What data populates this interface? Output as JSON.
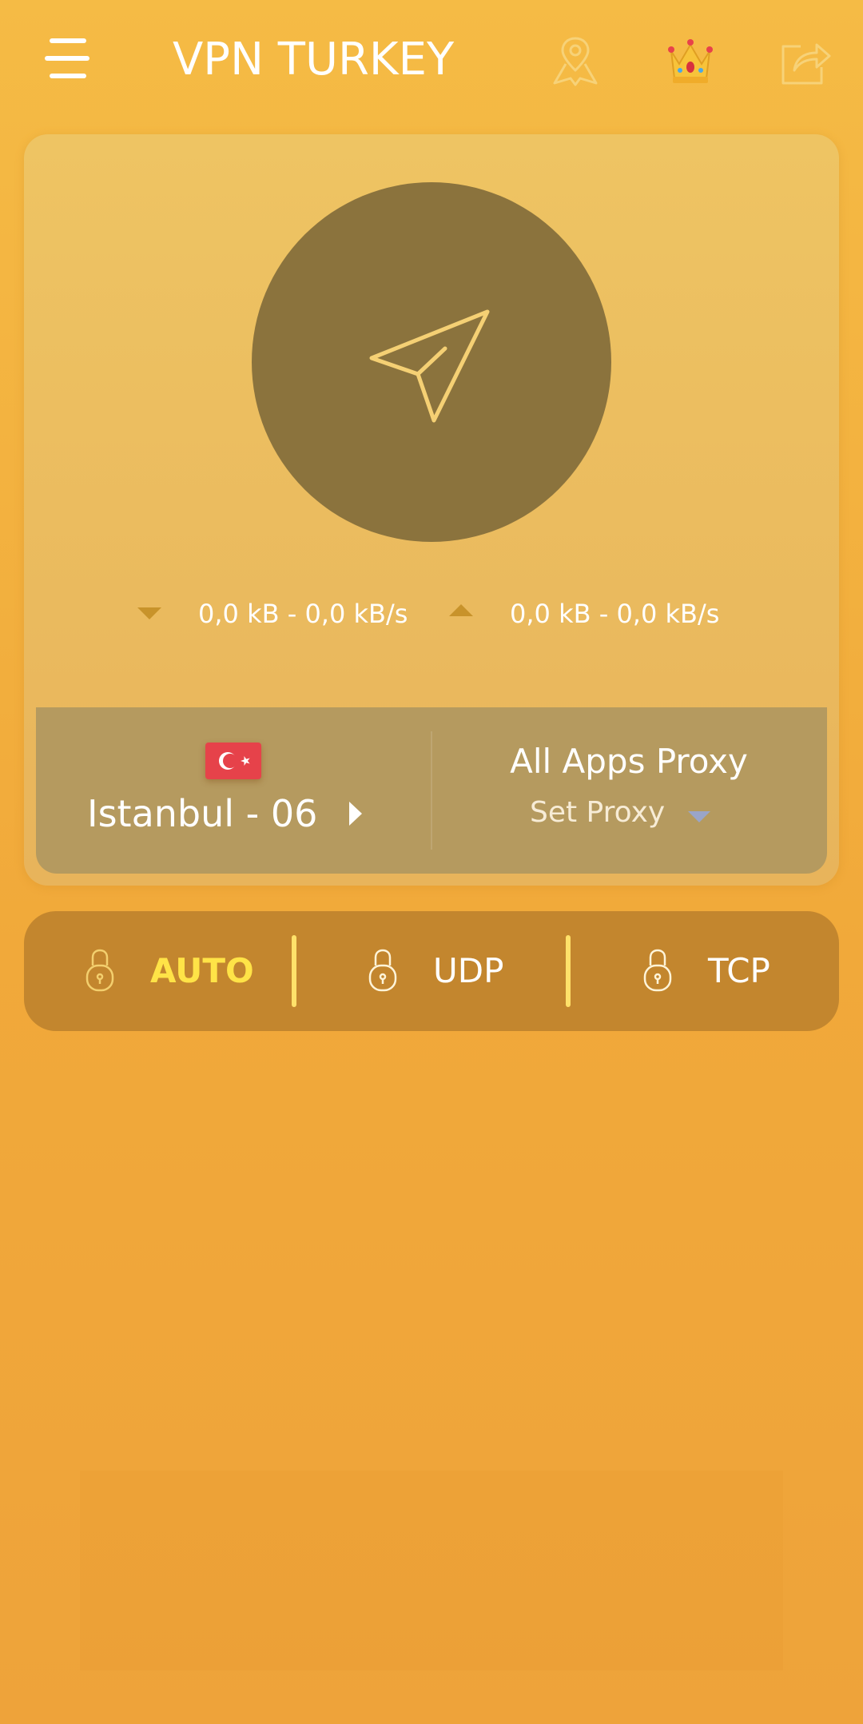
{
  "header": {
    "title": "VPN TURKEY",
    "menu_icon": "hamburger-menu-icon",
    "location_icon": "map-pin-icon",
    "premium_icon": "crown-icon",
    "share_icon": "share-icon"
  },
  "connect": {
    "button_icon": "paper-plane-icon",
    "download_text": "0,0 kB - 0,0 kB/s",
    "upload_text": "0,0 kB - 0,0 kB/s"
  },
  "server": {
    "flag": "turkey-flag",
    "name": "Istanbul - 06"
  },
  "proxy": {
    "title": "All Apps Proxy",
    "selected": "Set Proxy"
  },
  "protocols": {
    "options": [
      {
        "label": "AUTO",
        "selected": true
      },
      {
        "label": "UDP",
        "selected": false
      },
      {
        "label": "TCP",
        "selected": false
      }
    ]
  },
  "colors": {
    "background": "#f3b13f",
    "card": "#ebbd5f",
    "connect_circle": "#8b733d",
    "server_panel": "#b59a5f",
    "protocol_bar": "#c3862e",
    "selected_protocol": "#ffe347",
    "flag_red": "#e6424a"
  }
}
